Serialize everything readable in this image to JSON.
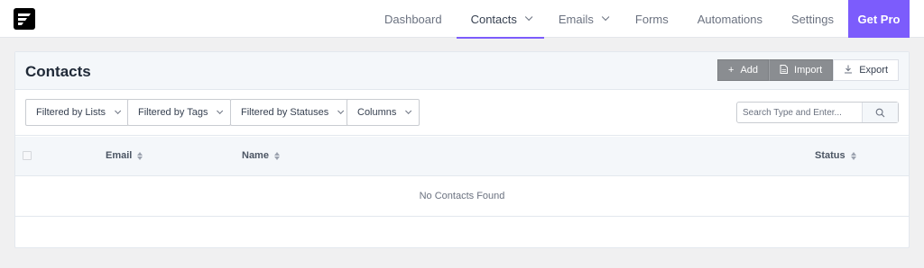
{
  "brand": {
    "logo_icon": "fluentcrm-logo-icon"
  },
  "nav": {
    "items": [
      {
        "label": "Dashboard",
        "dropdown": false,
        "active": false
      },
      {
        "label": "Contacts",
        "dropdown": true,
        "active": true
      },
      {
        "label": "Emails",
        "dropdown": true,
        "active": false
      },
      {
        "label": "Forms",
        "dropdown": false,
        "active": false
      },
      {
        "label": "Automations",
        "dropdown": false,
        "active": false
      },
      {
        "label": "Settings",
        "dropdown": false,
        "active": false
      }
    ],
    "cta_label": "Get Pro"
  },
  "colors": {
    "accent": "#7c5cfc",
    "dark_button": "#8a8d91",
    "header_bg": "#f4f7fa"
  },
  "page": {
    "title": "Contacts",
    "actions": {
      "add_label": "Add",
      "import_label": "Import",
      "export_label": "Export"
    }
  },
  "filters": {
    "lists_label": "Filtered by Lists",
    "tags_label": "Filtered by Tags",
    "statuses_label": "Filtered by Statuses",
    "columns_label": "Columns"
  },
  "search": {
    "placeholder": "Search Type and Enter...",
    "value": ""
  },
  "table": {
    "columns": [
      "Email",
      "Name",
      "Status"
    ],
    "empty_text": "No Contacts Found"
  }
}
